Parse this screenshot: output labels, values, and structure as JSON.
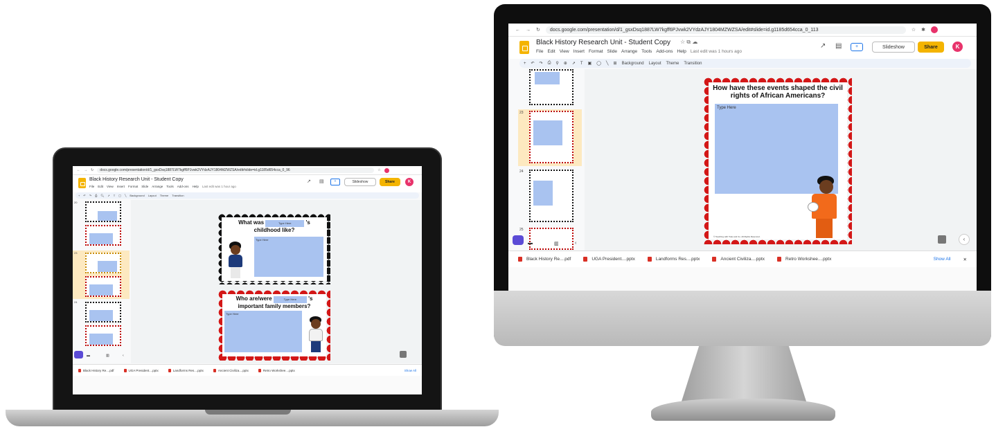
{
  "monitor": {
    "url": "docs.google.com/presentation/d/1_gsxDsq1887LW7kgff6PJvwk2VYdzAJY1804MZWZSA/edit#slide=id.g1185d654cca_0_113",
    "doc_title": "Black History Research Unit - Student Copy",
    "menus": [
      "File",
      "Edit",
      "View",
      "Insert",
      "Format",
      "Slide",
      "Arrange",
      "Tools",
      "Add-ons",
      "Help"
    ],
    "last_edit": "Last edit was 1 hours ago",
    "slideshow_label": "Slideshow",
    "share_label": "Share",
    "avatar_letter": "K",
    "toolbar": {
      "background": "Background",
      "layout": "Layout",
      "theme": "Theme",
      "transition": "Transition"
    },
    "thumb_numbers": [
      "23",
      "24",
      "25"
    ],
    "slide": {
      "title": "How have these events shaped the civil rights of African Americans?",
      "type_here": "Type Here",
      "footer": "© Teaching with Tulip and Co. All Rights Reserved."
    },
    "downloads": [
      "Black History Re....pdf",
      "UGA President....pptx",
      "Landforms Res....pptx",
      "Ancient Civiliza....pptx",
      "Retro Workshee....pptx"
    ],
    "show_all": "Show All"
  },
  "laptop": {
    "url": "docs.google.com/presentation/d/1_gsxDsq1887LW7kgff6PJvwk2VYdzAJY1804MZWZSA/edit#slide=id.g1185d654cca_0_96",
    "doc_title": "Black History Research Unit - Student Copy",
    "menus": [
      "File",
      "Edit",
      "View",
      "Insert",
      "Format",
      "Slide",
      "Arrange",
      "Tools",
      "Add-ons",
      "Help"
    ],
    "last_edit": "Last edit was 1 hour ago",
    "slideshow_label": "Slideshow",
    "share_label": "Share",
    "avatar_letter": "K",
    "toolbar": {
      "background": "Background",
      "layout": "Layout",
      "theme": "Theme",
      "transition": "Transition"
    },
    "thumb_numbers": [
      "20",
      "23",
      "24"
    ],
    "slide1": {
      "prefix": "What was",
      "blank": "Type Here",
      "suffix": "'s",
      "line2": "childhood like?",
      "type_here": "Type Here"
    },
    "slide2": {
      "prefix": "Who are/were",
      "blank": "Type Here",
      "suffix": "'s",
      "line2": "important family members?",
      "type_here": "Type Here"
    },
    "downloads": [
      "Black History Re....pdf",
      "UGA President....pptx",
      "Landforms Res....pptx",
      "Ancient Civiliza....pptx",
      "Retro Workshee....pptx"
    ],
    "show_all": "Show All"
  },
  "colors": {
    "accent": "#f4b400",
    "avatar": "#e8336b",
    "field": "#a9c3f0",
    "scallop_red": "#d31717"
  }
}
